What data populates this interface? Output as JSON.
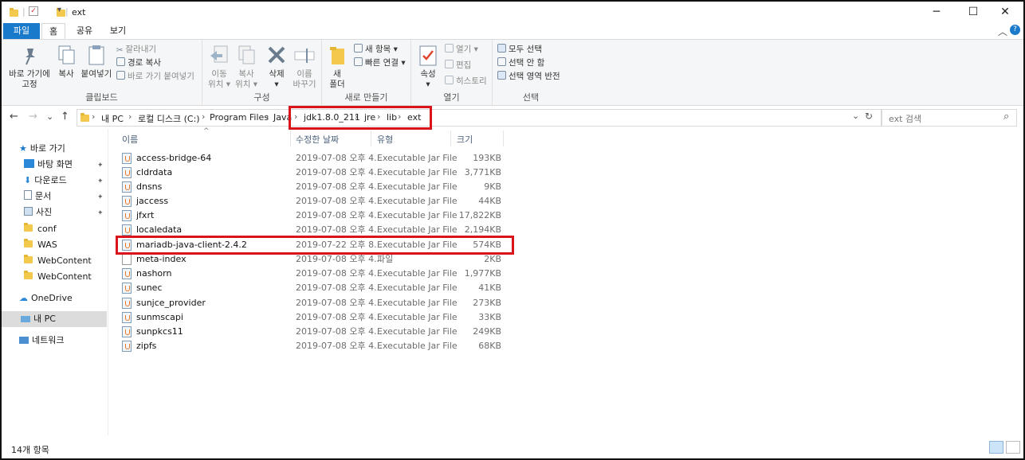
{
  "window": {
    "title": "ext",
    "minimize_glyph": "─",
    "maximize_glyph": "☐",
    "close_glyph": "✕",
    "quick_access_dropdown": "▾"
  },
  "tabs": [
    {
      "label": "파일"
    },
    {
      "label": "홈"
    },
    {
      "label": "공유"
    },
    {
      "label": "보기"
    }
  ],
  "ribbon": {
    "collapse_glyph": "︿",
    "help_glyph": "?",
    "clipboard": {
      "title": "클립보드",
      "pin_label": "바로 가기에\n고정",
      "copy_label": "복사",
      "paste_label": "붙여넣기",
      "cut_label": "잘라내기",
      "copy_path_label": "경로 복사",
      "paste_shortcut_label": "바로 가기 붙여넣기"
    },
    "organize": {
      "title": "구성",
      "move_label": "이동\n위치 ▾",
      "copyto_label": "복사\n위치 ▾",
      "delete_label": "삭제\n▾",
      "rename_label": "이름\n바꾸기"
    },
    "new": {
      "title": "새로 만들기",
      "folder_label": "새\n폴더",
      "new_item_label": "새 항목 ▾",
      "easy_access_label": "빠른 연결 ▾"
    },
    "open": {
      "title": "열기",
      "properties_label": "속성\n▾",
      "open_label": "열기 ▾",
      "edit_label": "편집",
      "history_label": "히스토리"
    },
    "select": {
      "title": "선택",
      "select_all_label": "모두 선택",
      "select_none_label": "선택 안 함",
      "invert_label": "선택 영역 반전"
    }
  },
  "address": {
    "back_glyph": "←",
    "forward_glyph": "→",
    "recent_glyph": "⌄",
    "up_glyph": "↑",
    "crumbs": [
      "내 PC",
      "로컬 디스크 (C:)",
      "Program Files",
      "Java",
      "jdk1.8.0_211",
      "jre",
      "lib",
      "ext"
    ],
    "crumb_separator": "›",
    "history_glyph": "⌄",
    "refresh_glyph": "↻",
    "search_placeholder": "ext 검색",
    "search_glyph": "⌕"
  },
  "nav_pane": {
    "quick_access": "바로 가기",
    "pinned": [
      "바탕 화면",
      "다운로드",
      "문서",
      "사진"
    ],
    "pin_glyph": "✦",
    "folders": [
      "conf",
      "WAS",
      "WebContent",
      "WebContent"
    ],
    "onedrive": "OneDrive",
    "this_pc": "내 PC",
    "network": "네트워크"
  },
  "columns": {
    "sort_glyph": "^",
    "name": "이름",
    "date": "수정한 날짜",
    "type": "유형",
    "size": "크기"
  },
  "files": [
    {
      "name": "access-bridge-64",
      "date": "2019-07-08 오후 4...",
      "type": "Executable Jar File",
      "size": "193KB"
    },
    {
      "name": "cldrdata",
      "date": "2019-07-08 오후 4...",
      "type": "Executable Jar File",
      "size": "3,771KB"
    },
    {
      "name": "dnsns",
      "date": "2019-07-08 오후 4...",
      "type": "Executable Jar File",
      "size": "9KB"
    },
    {
      "name": "jaccess",
      "date": "2019-07-08 오후 4...",
      "type": "Executable Jar File",
      "size": "44KB"
    },
    {
      "name": "jfxrt",
      "date": "2019-07-08 오후 4...",
      "type": "Executable Jar File",
      "size": "17,822KB"
    },
    {
      "name": "localedata",
      "date": "2019-07-08 오후 4...",
      "type": "Executable Jar File",
      "size": "2,194KB"
    },
    {
      "name": "mariadb-java-client-2.4.2",
      "date": "2019-07-22 오후 8...",
      "type": "Executable Jar File",
      "size": "574KB"
    },
    {
      "name": "meta-index",
      "date": "2019-07-08 오후 4...",
      "type": "파일",
      "size": "2KB"
    },
    {
      "name": "nashorn",
      "date": "2019-07-08 오후 4...",
      "type": "Executable Jar File",
      "size": "1,977KB"
    },
    {
      "name": "sunec",
      "date": "2019-07-08 오후 4...",
      "type": "Executable Jar File",
      "size": "41KB"
    },
    {
      "name": "sunjce_provider",
      "date": "2019-07-08 오후 4...",
      "type": "Executable Jar File",
      "size": "273KB"
    },
    {
      "name": "sunmscapi",
      "date": "2019-07-08 오후 4...",
      "type": "Executable Jar File",
      "size": "33KB"
    },
    {
      "name": "sunpkcs11",
      "date": "2019-07-08 오후 4...",
      "type": "Executable Jar File",
      "size": "249KB"
    },
    {
      "name": "zipfs",
      "date": "2019-07-08 오후 4...",
      "type": "Executable Jar File",
      "size": "68KB"
    }
  ],
  "status": {
    "count": "14개 항목"
  },
  "colors": {
    "accent": "#1979ca",
    "highlight_box": "#d9141b",
    "folder": "#f2c94c"
  }
}
